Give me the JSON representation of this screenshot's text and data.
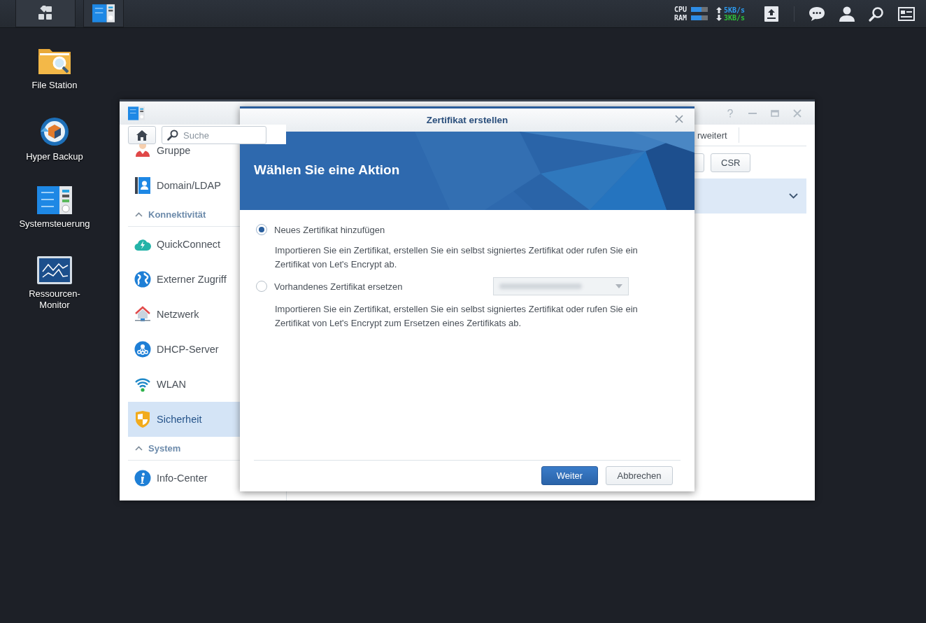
{
  "tray": {
    "meters": [
      {
        "label": "CPU",
        "level": 0.65
      },
      {
        "label": "RAM",
        "level": 0.65
      }
    ],
    "upload": "5KB/s",
    "download": "3KB/s"
  },
  "desktop_icons": [
    {
      "label": "File Station"
    },
    {
      "label": "Hyper Backup"
    },
    {
      "label": "Systemsteuerung"
    },
    {
      "label": "Ressourcen-Monitor"
    }
  ],
  "window": {
    "search": {
      "placeholder": "Suche"
    },
    "sidebar": [
      {
        "kind": "item",
        "label": "Gruppe",
        "selected": false
      },
      {
        "kind": "item",
        "label": "Domain/LDAP",
        "selected": false
      },
      {
        "kind": "section",
        "label": "Konnektivität",
        "expanded": true
      },
      {
        "kind": "item",
        "label": "QuickConnect",
        "selected": false
      },
      {
        "kind": "item",
        "label": "Externer Zugriff",
        "selected": false
      },
      {
        "kind": "item",
        "label": "Netzwerk",
        "selected": false
      },
      {
        "kind": "item",
        "label": "DHCP-Server",
        "selected": false
      },
      {
        "kind": "item",
        "label": "WLAN",
        "selected": false
      },
      {
        "kind": "item",
        "label": "Sicherheit",
        "selected": true
      },
      {
        "kind": "section",
        "label": "System",
        "expanded": true
      },
      {
        "kind": "item",
        "label": "Info-Center",
        "selected": false
      }
    ],
    "tabs": [
      {
        "label": "rweitert"
      }
    ],
    "toolbar_buttons": [
      {
        "label": "CSR"
      }
    ],
    "certificate_row": {
      "selected": true
    }
  },
  "dialog": {
    "title": "Zertifikat erstellen",
    "heading": "Wählen Sie eine Aktion",
    "options": [
      {
        "label": "Neues Zertifikat hinzufügen",
        "selected": true,
        "description": "Importieren Sie ein Zertifikat, erstellen Sie ein selbst signiertes Zertifikat oder rufen Sie ein Zertifikat von Let's Encrypt ab."
      },
      {
        "label": "Vorhandenes Zertifikat ersetzen",
        "selected": false,
        "dropdown": {
          "disabled": true
        },
        "description": "Importieren Sie ein Zertifikat, erstellen Sie ein selbst signiertes Zertifikat oder rufen Sie ein Zertifikat von Let's Encrypt zum Ersetzen eines Zertifikats ab."
      }
    ],
    "buttons": [
      {
        "label": "Weiter",
        "kind": "primary"
      },
      {
        "label": "Abbrechen",
        "kind": "secondary"
      }
    ]
  }
}
